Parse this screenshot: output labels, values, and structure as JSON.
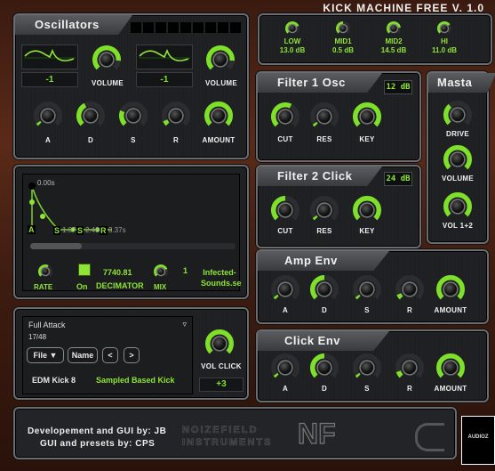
{
  "app": {
    "title": "KICK MACHINE FREE  V. 1.0"
  },
  "colors": {
    "accent": "#7fe02a",
    "knob_track": "#2c2d30",
    "background": "#4a2214"
  },
  "oscillators": {
    "title": "Oscillators",
    "osc1": {
      "waveform": "saw-wave",
      "value": "-1",
      "volume_label": "VOLUME",
      "volume": 0.85
    },
    "osc2": {
      "waveform": "saw-wave",
      "value": "-1",
      "volume_label": "VOLUME",
      "volume": 0.85
    },
    "env": [
      {
        "label": "A",
        "value": 0.0
      },
      {
        "label": "D",
        "value": 0.4
      },
      {
        "label": "S",
        "value": 0.25
      },
      {
        "label": "R",
        "value": 0.08
      },
      {
        "label": "AMOUNT",
        "value": 1.0
      }
    ],
    "preset_slots": 9
  },
  "eq": {
    "bands": [
      {
        "label": "LOW",
        "value": "13.0 dB",
        "level": 0.75
      },
      {
        "label": "MID1",
        "value": "0.5 dB",
        "level": 0.5
      },
      {
        "label": "MID2",
        "value": "14.5 dB",
        "level": 0.8
      },
      {
        "label": "HI",
        "value": "11.0 dB",
        "level": 0.7
      }
    ]
  },
  "filter1": {
    "title": "Filter 1 Osc",
    "slope": "12 dB",
    "knobs": [
      {
        "label": "CUT",
        "value": 0.6
      },
      {
        "label": "RES",
        "value": 0.0
      },
      {
        "label": "KEY",
        "value": 1.0
      }
    ]
  },
  "filter2": {
    "title": "Filter 2 Click",
    "slope": "24 dB",
    "knobs": [
      {
        "label": "CUT",
        "value": 0.5
      },
      {
        "label": "RES",
        "value": 0.0
      },
      {
        "label": "KEY",
        "value": 1.0
      }
    ]
  },
  "master": {
    "title": "Masta",
    "knobs": [
      {
        "label": "DRIVE",
        "value": 0.35
      },
      {
        "label": "VOLUME",
        "value": 1.0
      },
      {
        "label": "VOL 1+2",
        "value": 1.0
      }
    ]
  },
  "envelope_display": {
    "start_time": "0.00s",
    "markers": [
      {
        "letter": "A"
      },
      {
        "letter": "S",
        "time": "1.07"
      },
      {
        "letter": "S",
        "time": "2.48"
      },
      {
        "letter": "R",
        "time": "3.37s"
      }
    ],
    "scroll_position": 0.25
  },
  "decimator": {
    "rate_label": "RATE",
    "rate": 0.6,
    "on_label": "On",
    "enabled": true,
    "value": "7740.81",
    "label": "DECIMATOR",
    "mix_label": "MIX",
    "mix": 0.75,
    "mix_value": "1",
    "credit": "Infected-Sounds.se"
  },
  "preset": {
    "category": "Full Attack",
    "index": "17/48",
    "file_button": "File ▼",
    "name_button": "Name",
    "prev_button": "<",
    "next_button": ">",
    "name": "EDM Kick 8",
    "type": "Sampled Based Kick",
    "vol_click_label": "VOL CLICK",
    "vol_click": 1.0,
    "vol_click_value": "+3"
  },
  "amp_env": {
    "title": "Amp Env",
    "knobs": [
      {
        "label": "A",
        "value": 0.0
      },
      {
        "label": "D",
        "value": 0.5
      },
      {
        "label": "S",
        "value": 0.0
      },
      {
        "label": "R",
        "value": 0.08
      },
      {
        "label": "AMOUNT",
        "value": 1.0
      }
    ]
  },
  "click_env": {
    "title": "Click Env",
    "knobs": [
      {
        "label": "A",
        "value": 0.0
      },
      {
        "label": "D",
        "value": 0.5
      },
      {
        "label": "S",
        "value": 0.0
      },
      {
        "label": "R",
        "value": 0.1
      },
      {
        "label": "AMOUNT",
        "value": 1.0
      }
    ]
  },
  "footer": {
    "credit_line1": "Developement and GUI by: JB",
    "credit_line2": "GUI and presets by: CPS",
    "logo_text_1": "NOIZEFIELD",
    "logo_text_2": "INSTRUMENTS",
    "logo_mark": "NF",
    "watermark": "AUDIOZ"
  }
}
